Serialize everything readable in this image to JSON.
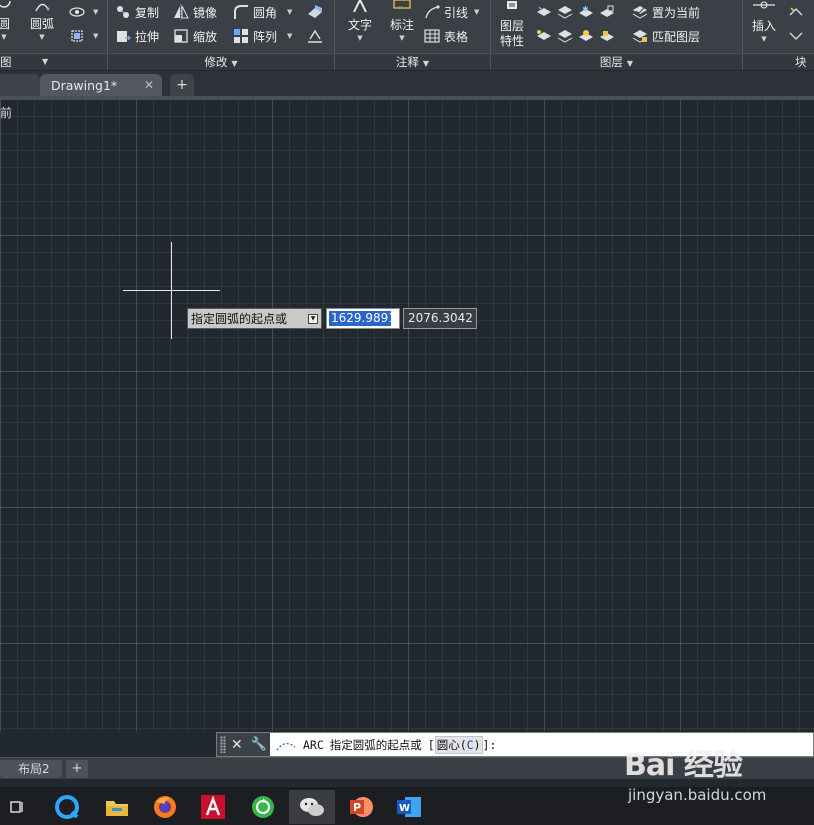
{
  "ribbon": {
    "draw_panel": {
      "title": "图",
      "arc_label": "圆弧",
      "circle_label": "圆"
    },
    "modify_panel": {
      "title": "修改",
      "copy": "复制",
      "mirror": "镜像",
      "fillet": "圆角",
      "stretch": "拉伸",
      "scale": "缩放",
      "array": "阵列"
    },
    "annotation_panel": {
      "title": "注释",
      "text": "文字",
      "dimension": "标注",
      "leader": "引线",
      "table": "表格"
    },
    "layers_panel": {
      "title": "图层",
      "properties_line1": "图层",
      "properties_line2": "特性",
      "set_current": "置为当前",
      "match_layer": "匹配图层"
    },
    "block_panel": {
      "title": "块",
      "insert": "插入"
    }
  },
  "file_tabs": {
    "active": "Drawing1*",
    "close_glyph": "✕",
    "add_glyph": "+"
  },
  "viewport_label": "前",
  "dynamic_input": {
    "prompt": "指定圆弧的起点或",
    "x_value": "1629.9891",
    "y_value": "2076.3042"
  },
  "command_line": {
    "command": "ARC",
    "prompt": "指定圆弧的起点或",
    "bracket_open": "[",
    "option_text": "圆心(",
    "option_key": "C",
    "option_close": ")",
    "bracket_close": "]:"
  },
  "layout_tabs": {
    "tab": "布局2",
    "add_glyph": "+"
  },
  "watermark": {
    "logo": "Bai 经验",
    "url": "jingyan.baidu.com"
  },
  "colors": {
    "canvas": "#212830",
    "ribbon": "#3b3f46",
    "selection": "#2a66c9"
  }
}
